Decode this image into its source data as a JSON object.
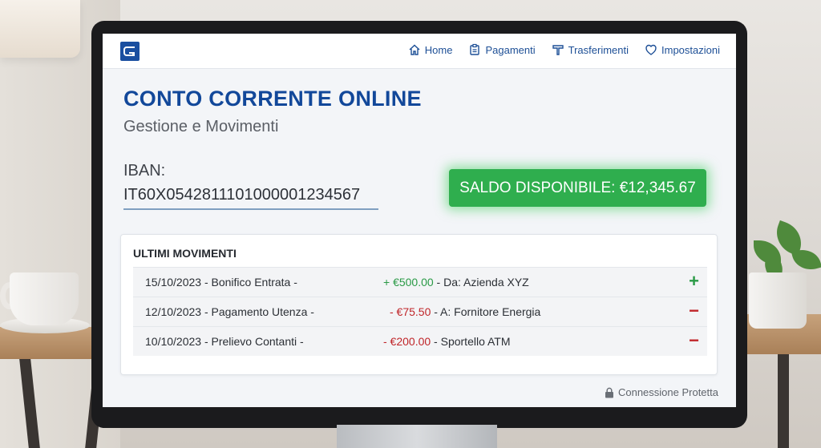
{
  "nav": {
    "items": [
      {
        "label": "Home",
        "icon": "home-icon"
      },
      {
        "label": "Pagamenti",
        "icon": "clipboard-icon"
      },
      {
        "label": "Trasferimenti",
        "icon": "transfer-icon"
      },
      {
        "label": "Impostazioni",
        "icon": "shield-icon"
      }
    ]
  },
  "header": {
    "title": "CONTO CORRENTE ONLINE",
    "subtitle": "Gestione e Movimenti"
  },
  "account": {
    "iban_label": "IBAN:",
    "iban_value": "IT60X0542811101000001234567",
    "balance": "SALDO DISPONIBILE: €12,345.67"
  },
  "movements": {
    "title": "ULTIMI MOVIMENTI",
    "rows": [
      {
        "desc": "15/10/2023 - Bonifico Entrata -",
        "amount": "+ €500.00",
        "detail": " - Da: Azienda XYZ",
        "sign": "+",
        "type": "positive"
      },
      {
        "desc": "12/10/2023 - Pagamento Utenza -",
        "amount": "- €75.50",
        "detail": " - A: Fornitore Energia",
        "sign": "−",
        "type": "negative"
      },
      {
        "desc": "10/10/2023 - Prelievo Contanti -",
        "amount": "- €200.00",
        "detail": " - Sportello ATM",
        "sign": "−",
        "type": "negative"
      }
    ]
  },
  "footer": {
    "secure_label": "Connessione Protetta",
    "icon": "lock-icon"
  },
  "colors": {
    "primary": "#12489a",
    "balance_green": "#2fae4e",
    "positive": "#2a9a46",
    "negative": "#c0262a"
  }
}
